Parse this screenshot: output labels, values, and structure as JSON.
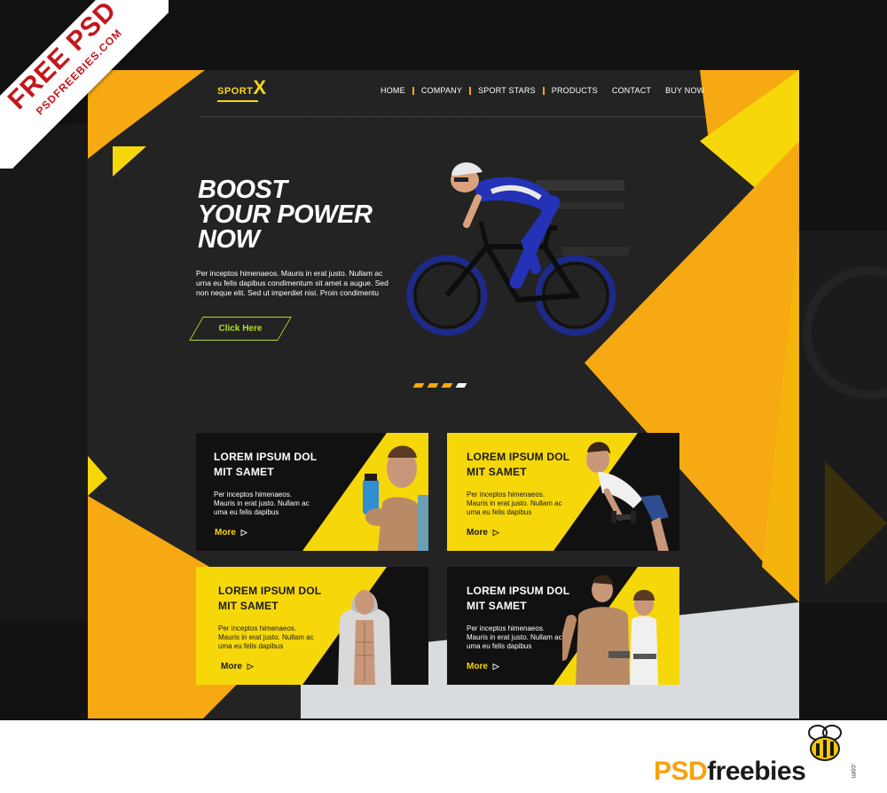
{
  "ribbon": {
    "line1": "FREE PSD",
    "line2": "PSDFREEBIES.COM"
  },
  "logo": {
    "sport": "SPORT",
    "x": "X"
  },
  "nav": {
    "items": [
      "HOME",
      "COMPANY",
      "SPORT STARS",
      "PRODUCTS",
      "CONTACT",
      "BUY NOW"
    ]
  },
  "hero": {
    "title_line1": "BOOST",
    "title_line2": "YOUR POWER",
    "title_line3": "NOW",
    "text": "Per inceptos himenaeos. Mauris in erat justo. Nullam ac urna eu felis dapibus condimentum sit amet a augue. Sed non neque elit. Sed ut imperdiet nisi. Proin condimentu",
    "cta_label": "Click Here"
  },
  "cards": [
    {
      "title_line1": "LOREM IPSUM DOL",
      "title_line2": "MIT SAMET",
      "text": "Per inceptos himenaeos. Mauris in erat justo. Nullam ac uma eu felis dapibus",
      "more": "More"
    },
    {
      "title_line1": "LOREM IPSUM DOL",
      "title_line2": "MIT SAMET",
      "text": "Per inceptos himenaeos. Mauris in erat justo. Nullam ac uma eu felis dapibus",
      "more": "More"
    },
    {
      "title_line1": "LOREM IPSUM DOL",
      "title_line2": "MIT SAMET",
      "text": "Per inceptos himenaeos. Mauris in erat justo. Nullam ac uma eu felis dapibus",
      "more": "More"
    },
    {
      "title_line1": "LOREM IPSUM DOL",
      "title_line2": "MIT SAMET",
      "text": "Per inceptos himenaeos. Mauris in erat justo. Nullam ac uma eu felis dapibus",
      "more": "More"
    }
  ],
  "more_arrow": "▷",
  "brand": {
    "psd": "PSD",
    "rest": "freebies",
    "com": ".com"
  },
  "colors": {
    "orange": "#f7a913",
    "yellow": "#f6d70a",
    "dark": "#232323",
    "green": "#b5de2a",
    "ribbon_red": "#c4161c"
  }
}
